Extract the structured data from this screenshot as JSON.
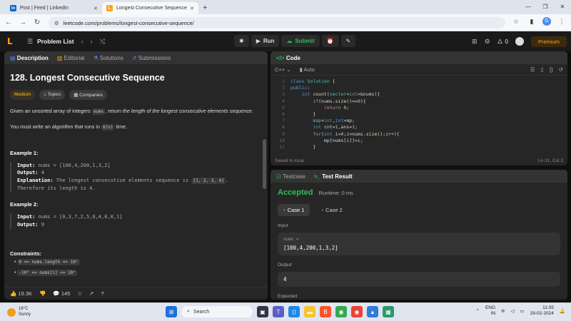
{
  "browser": {
    "tabs": [
      {
        "title": "Post | Feed | LinkedIn",
        "active": false,
        "fav": "in",
        "color": "#0a66c2"
      },
      {
        "title": "Longest Consecutive Sequence",
        "active": true,
        "fav": "L",
        "color": "#ffa116"
      }
    ],
    "url": "leetcode.com/problems/longest-consecutive-sequence/"
  },
  "header": {
    "problem_list": "Problem List",
    "run": "Run",
    "submit": "Submit",
    "streak": "0",
    "premium": "Premium"
  },
  "left": {
    "tabs": [
      "Description",
      "Editorial",
      "Solutions",
      "Submissions"
    ],
    "title": "128. Longest Consecutive Sequence",
    "difficulty": "Medium",
    "topics": "Topics",
    "companies": "Companies",
    "desc1_a": "Given an unsorted array of integers ",
    "desc1_code": "nums",
    "desc1_b": ", return ",
    "desc1_em": "the length of the longest consecutive elements sequence.",
    "desc2_a": "You must write an algorithm that runs in ",
    "desc2_code": "O(n)",
    "desc2_b": " time.",
    "ex1": {
      "title": "Example 1:",
      "input_label": "Input:",
      "input": "nums = [100,4,200,1,3,2]",
      "output_label": "Output:",
      "output": "4",
      "expl_label": "Explanation:",
      "expl": "The longest consecutive elements sequence is",
      "expl_code": "[1, 2, 3, 4]",
      "expl2": "Therefore its length is 4."
    },
    "ex2": {
      "title": "Example 2:",
      "input_label": "Input:",
      "input": "nums = [0,3,7,2,5,8,4,6,0,1]",
      "output_label": "Output:",
      "output": "9"
    },
    "constraints_title": "Constraints:",
    "constraints": [
      "0 <= nums.length <= 10⁵",
      "-10⁹ <= nums[i] <= 10⁹"
    ],
    "likes": "19.3K",
    "comments": "145"
  },
  "code": {
    "title": "Code",
    "lang": "C++",
    "mode": "Auto",
    "saved": "Saved to local",
    "pos": "Ln 31, Col 3"
  },
  "result": {
    "tabs": [
      "Testcase",
      "Test Result"
    ],
    "status": "Accepted",
    "runtime": "Runtime: 0 ms",
    "cases": [
      "Case 1",
      "Case 2"
    ],
    "input_label": "Input",
    "input_sub": "nums =",
    "input_val": "[100,4,200,1,3,2]",
    "output_label": "Output",
    "output_val": "4",
    "expected_label": "Expected"
  },
  "taskbar": {
    "temp": "18°C",
    "weather": "Sunny",
    "search": "Search",
    "lang1": "ENG",
    "lang2": "IN",
    "time": "11:05",
    "date": "29-02-2024"
  }
}
